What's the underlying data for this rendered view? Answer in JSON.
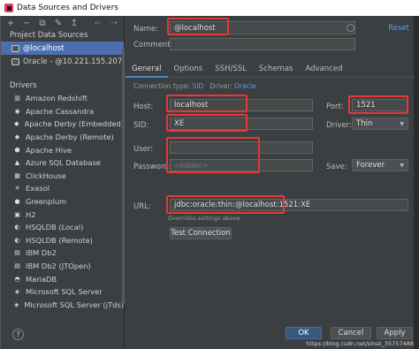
{
  "window": {
    "title": "Data Sources and Drivers"
  },
  "left": {
    "toolbar": {
      "add": "+",
      "remove": "−",
      "copy": "⧉",
      "settings": "🔧",
      "back": "←",
      "forward": "→"
    },
    "project_title": "Project Data Sources",
    "data_sources": [
      {
        "label": "@localhost"
      },
      {
        "label": "Oracle - @10.221.155.207"
      }
    ],
    "drivers_title": "Drivers",
    "drivers": [
      {
        "label": "Amazon Redshift",
        "icon": "redshift-icon"
      },
      {
        "label": "Apache Cassandra",
        "icon": "cassandra-icon"
      },
      {
        "label": "Apache Derby (Embedded)",
        "icon": "derby-icon"
      },
      {
        "label": "Apache Derby (Remote)",
        "icon": "derby-icon"
      },
      {
        "label": "Apache Hive",
        "icon": "hive-icon"
      },
      {
        "label": "Azure SQL Database",
        "icon": "azure-icon"
      },
      {
        "label": "ClickHouse",
        "icon": "clickhouse-icon"
      },
      {
        "label": "Exasol",
        "icon": "exasol-icon"
      },
      {
        "label": "Greenplum",
        "icon": "greenplum-icon"
      },
      {
        "label": "H2",
        "icon": "h2-icon"
      },
      {
        "label": "HSQLDB (Local)",
        "icon": "hsqldb-icon"
      },
      {
        "label": "HSQLDB (Remote)",
        "icon": "hsqldb-icon"
      },
      {
        "label": "IBM Db2",
        "icon": "db2-icon"
      },
      {
        "label": "IBM Db2 (JTOpen)",
        "icon": "db2-icon"
      },
      {
        "label": "MariaDB",
        "icon": "mariadb-icon"
      },
      {
        "label": "Microsoft SQL Server",
        "icon": "mssql-icon"
      },
      {
        "label": "Microsoft SQL Server (jTds)",
        "icon": "mssql-icon"
      }
    ],
    "help": "?"
  },
  "form": {
    "name_label": "Name:",
    "name_value": "@localhost",
    "reset": "Reset",
    "comment_label": "Comment:",
    "comment_value": "",
    "tabs": [
      "General",
      "Options",
      "SSH/SSL",
      "Schemas",
      "Advanced"
    ],
    "conn_type_label": "Connection type:",
    "conn_type_value": "SID",
    "driver_label": "Driver:",
    "driver_value": "Oracle",
    "host_label": "Host:",
    "host_value": "localhost",
    "port_label": "Port:",
    "port_value": "1521",
    "sid_label": "SID:",
    "sid_value": "XE",
    "driver2_label": "Driver:",
    "driver2_value": "Thin",
    "user_label": "User:",
    "user_value": "",
    "password_label": "Password:",
    "password_placeholder": "<hidden>",
    "save_label": "Save:",
    "save_value": "Forever",
    "url_label": "URL:",
    "url_value": "jdbc:oracle:thin:@localhost:1521:XE",
    "url_hint": "Overrides settings above",
    "test_connection": "Test Connection"
  },
  "footer": {
    "ok": "OK",
    "cancel": "Cancel",
    "apply": "Apply",
    "watermark": "https://blog.csdn.net/sinat_35757488"
  },
  "colors": {
    "selection": "#4b6eaf",
    "highlight": "#e53935",
    "link": "#589df6"
  }
}
